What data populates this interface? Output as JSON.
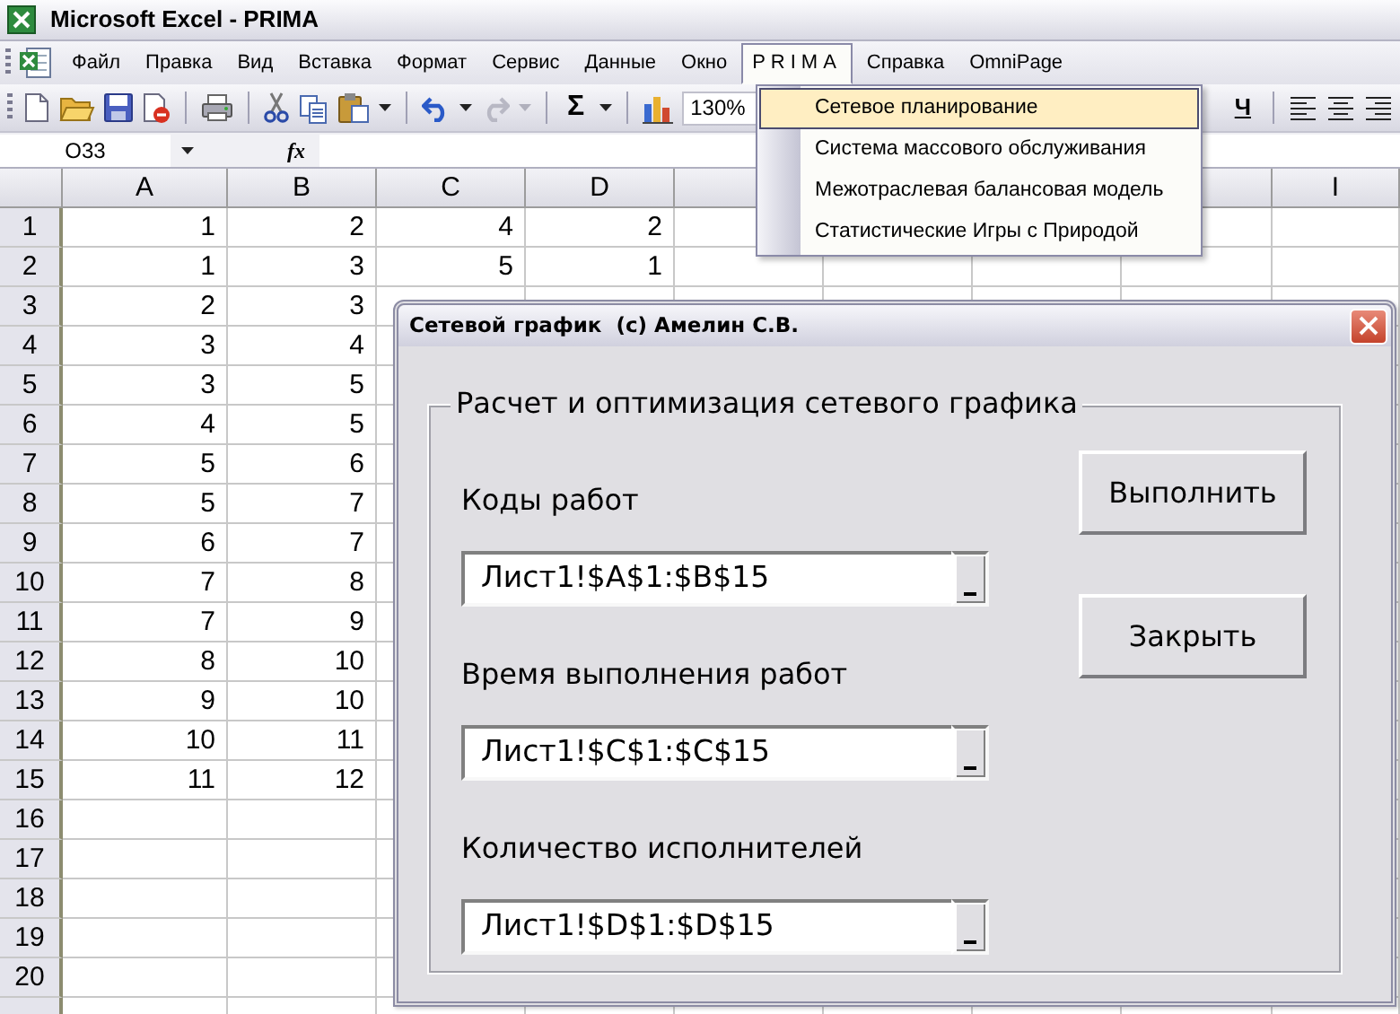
{
  "window": {
    "title": "Microsoft Excel - PRIMA"
  },
  "menu": [
    {
      "label": "Файл",
      "selected": false
    },
    {
      "label": "Правка",
      "selected": false
    },
    {
      "label": "Вид",
      "selected": false
    },
    {
      "label": "Вставка",
      "selected": false
    },
    {
      "label": "Формат",
      "selected": false
    },
    {
      "label": "Сервис",
      "selected": false
    },
    {
      "label": "Данные",
      "selected": false
    },
    {
      "label": "Окно",
      "selected": false
    },
    {
      "label": "PRIMA",
      "selected": true
    },
    {
      "label": "Справка",
      "selected": false
    },
    {
      "label": "OmniPage",
      "selected": false
    }
  ],
  "prima_menu": [
    {
      "label": "Сетевое планирование",
      "selected": true
    },
    {
      "label": "Система массового обслуживания",
      "selected": false
    },
    {
      "label": "Межотраслевая балансовая модель",
      "selected": false
    },
    {
      "label": "Статистические Игры с Природой",
      "selected": false
    }
  ],
  "toolbar": {
    "redo": {
      "disabled": true
    },
    "sum_symbol": "Σ",
    "zoom": "130%",
    "underline_label": "Ч"
  },
  "formula_bar": {
    "name_box": "O33",
    "function_label": "fx"
  },
  "sheet": {
    "column_headers_left": [
      "A",
      "B",
      "C",
      "D"
    ],
    "column_headers_right": [
      "I"
    ],
    "rows": [
      {
        "number": "1",
        "cells": [
          "1",
          "2",
          "4",
          "2"
        ]
      },
      {
        "number": "2",
        "cells": [
          "1",
          "3",
          "5",
          "1"
        ]
      },
      {
        "number": "3",
        "cells": [
          "2",
          "3"
        ]
      },
      {
        "number": "4",
        "cells": [
          "3",
          "4"
        ]
      },
      {
        "number": "5",
        "cells": [
          "3",
          "5"
        ]
      },
      {
        "number": "6",
        "cells": [
          "4",
          "5"
        ]
      },
      {
        "number": "7",
        "cells": [
          "5",
          "6"
        ]
      },
      {
        "number": "8",
        "cells": [
          "5",
          "7"
        ]
      },
      {
        "number": "9",
        "cells": [
          "6",
          "7"
        ]
      },
      {
        "number": "10",
        "cells": [
          "7",
          "8"
        ]
      },
      {
        "number": "11",
        "cells": [
          "7",
          "9"
        ]
      },
      {
        "number": "12",
        "cells": [
          "8",
          "10"
        ]
      },
      {
        "number": "13",
        "cells": [
          "9",
          "10"
        ]
      },
      {
        "number": "14",
        "cells": [
          "10",
          "11"
        ]
      },
      {
        "number": "15",
        "cells": [
          "11",
          "12"
        ]
      },
      {
        "number": "16",
        "cells": []
      },
      {
        "number": "17",
        "cells": []
      },
      {
        "number": "18",
        "cells": []
      },
      {
        "number": "19",
        "cells": []
      },
      {
        "number": "20",
        "cells": []
      }
    ]
  },
  "dialog": {
    "title": "Сетевой график  (с) Амелин С.В.",
    "group_title": "Расчет и оптимизация сетевого графика",
    "fields": [
      {
        "label": "Коды работ",
        "value": "Лист1!$A$1:$B$15"
      },
      {
        "label": "Время выполнения работ",
        "value": "Лист1!$C$1:$C$15"
      },
      {
        "label": "Количество исполнителей",
        "value": "Лист1!$D$1:$D$15"
      }
    ],
    "buttons": [
      "Выполнить",
      "Закрыть"
    ]
  }
}
